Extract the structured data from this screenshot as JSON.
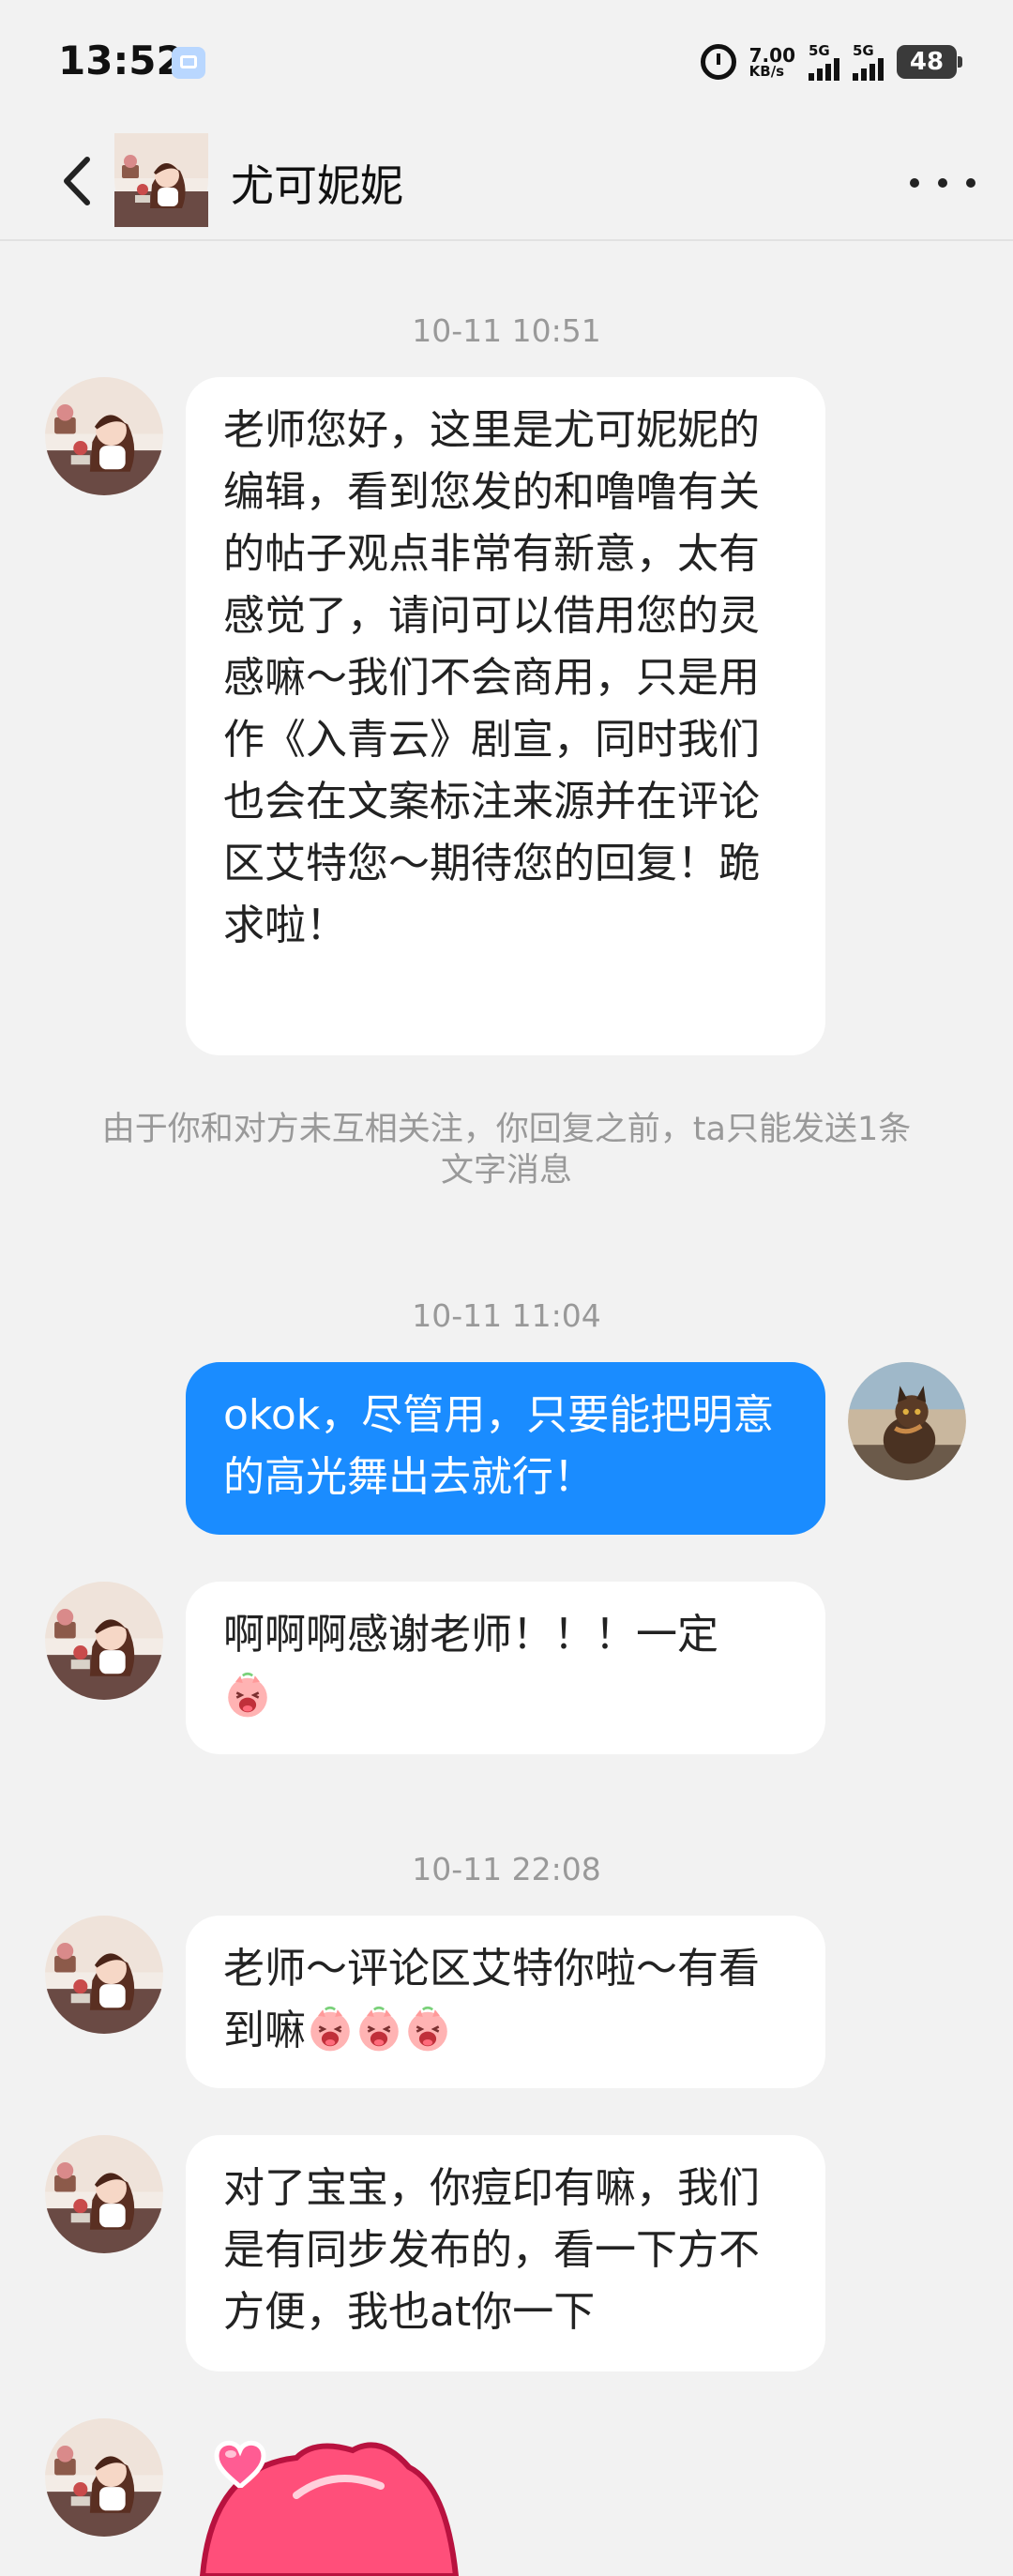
{
  "status_bar": {
    "time": "13:52",
    "net_speed_value": "7.00",
    "net_speed_unit": "KB/s",
    "sim1": "5G",
    "sim2": "5G",
    "battery": "48"
  },
  "header": {
    "title": "尤可妮妮"
  },
  "chat": {
    "timestamps": [
      "10-11 10:51",
      "10-11 11:04",
      "10-11 22:08"
    ],
    "system_notice": "由于你和对方未互相关注，你回复之前，ta只能发送1条文字消息",
    "messages": [
      {
        "sender": "尤可妮妮",
        "text": "老师您好，这里是尤可妮妮的编辑，看到您发的和噜噜有关的帖子观点非常有新意，太有感觉了，请问可以借用您的灵感嘛～我们不会商用，只是用作《入青云》剧宣，同时我们也会在文案标注来源并在评论区艾特您～期待您的回复！跪求啦！"
      },
      {
        "sender": "me",
        "text": "okok，尽管用，只要能把明意的高光舞出去就行！"
      },
      {
        "sender": "尤可妮妮",
        "text": "啊啊啊感谢老师！！！一定"
      },
      {
        "sender": "尤可妮妮",
        "text": "老师～评论区艾特你啦～有看到嘛"
      },
      {
        "sender": "尤可妮妮",
        "text": "对了宝宝，你痘印有嘛，我们是有同步发布的，看一下方不方便，我也at你一下"
      }
    ]
  },
  "icons": {
    "emoji": "pig-face-emoji",
    "sticker": "pink-heart-sticker"
  },
  "colors": {
    "my_bubble": "#1a8cff",
    "background": "#f2f2f2",
    "other_bubble": "#ffffff"
  }
}
